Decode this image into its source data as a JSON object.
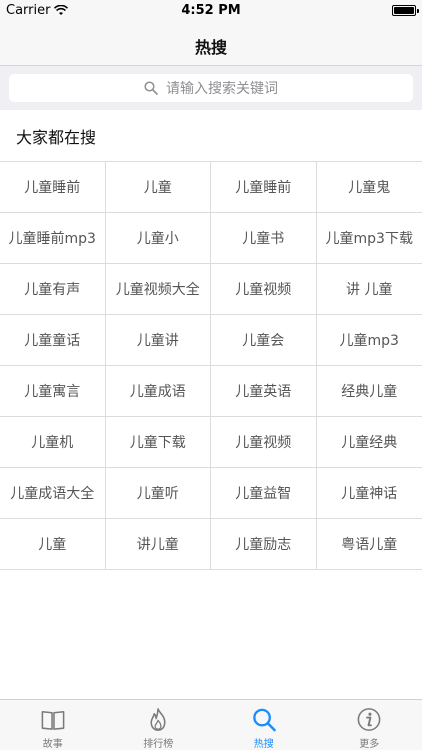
{
  "status": {
    "carrier": "Carrier",
    "time": "4:52 PM"
  },
  "nav": {
    "title": "热搜"
  },
  "search": {
    "placeholder": "请输入搜索关键词"
  },
  "section": {
    "title": "大家都在搜"
  },
  "grid": [
    [
      "儿童睡前",
      "儿童",
      "儿童睡前",
      "儿童鬼"
    ],
    [
      "儿童睡前mp3",
      "儿童小",
      "儿童书",
      "儿童mp3下载"
    ],
    [
      "儿童有声",
      "儿童视频大全",
      "儿童视频",
      "讲 儿童"
    ],
    [
      "儿童童话",
      "儿童讲",
      "儿童会",
      "儿童mp3"
    ],
    [
      "儿童寓言",
      "儿童成语",
      "儿童英语",
      "经典儿童"
    ],
    [
      "儿童机",
      "儿童下载",
      "儿童视频",
      "儿童经典"
    ],
    [
      "儿童成语大全",
      "儿童听",
      "儿童益智",
      "儿童神话"
    ],
    [
      "儿童",
      "讲儿童",
      "儿童励志",
      "粤语儿童"
    ]
  ],
  "tabs": [
    {
      "label": "故事",
      "icon": "book-icon"
    },
    {
      "label": "排行榜",
      "icon": "flame-icon"
    },
    {
      "label": "热搜",
      "icon": "search-icon",
      "active": true
    },
    {
      "label": "更多",
      "icon": "info-icon"
    }
  ],
  "colors": {
    "accent": "#1a8cff",
    "tab_inactive": "#7a7a7a"
  }
}
